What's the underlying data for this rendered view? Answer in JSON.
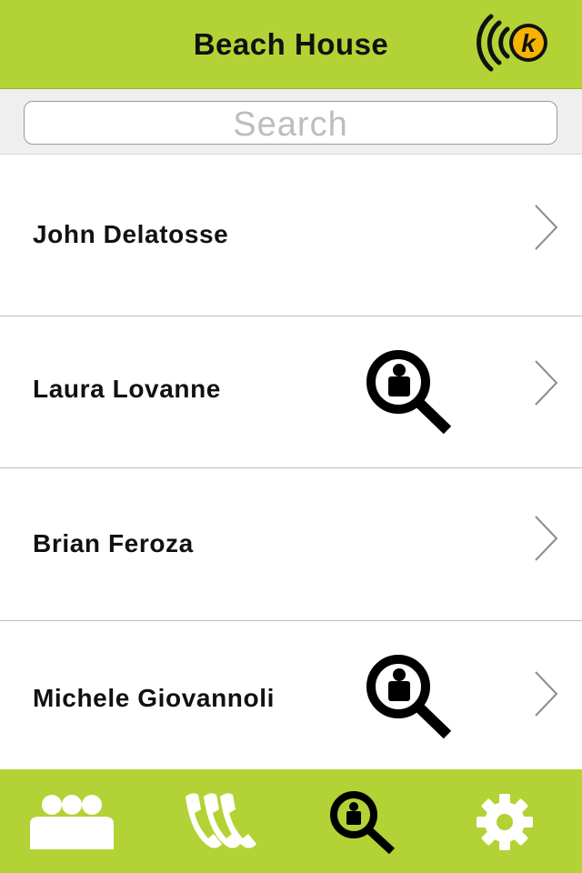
{
  "colors": {
    "accent": "#b3d235",
    "icon_dark": "#111111",
    "icon_light": "#ffffff"
  },
  "header": {
    "title": "Beach House",
    "logo_icon": "wireless-k-logo-icon",
    "logo_letter": "k"
  },
  "search": {
    "placeholder": "Search"
  },
  "contacts": [
    {
      "name": "John Delatosse",
      "tracked": false
    },
    {
      "name": "Laura Lovanne",
      "tracked": true
    },
    {
      "name": "Brian Feroza",
      "tracked": false
    },
    {
      "name": "Michele Giovannoli",
      "tracked": true
    }
  ],
  "tabs": [
    {
      "icon": "group-icon",
      "active": false
    },
    {
      "icon": "phone-icon",
      "active": false
    },
    {
      "icon": "person-search-icon",
      "active": true
    },
    {
      "icon": "gear-icon",
      "active": false
    }
  ]
}
